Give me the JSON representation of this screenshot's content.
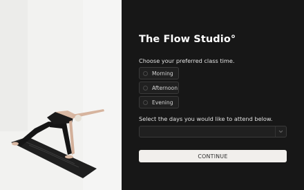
{
  "form": {
    "title": "The Flow Studio°",
    "class_time_label": "Choose your preferred class time.",
    "class_time_options": [
      "Morning",
      "Afternoon",
      "Evening"
    ],
    "days_label": "Select the days you would like to attend below.",
    "days_select_value": "",
    "continue_label": "CONTINUE"
  },
  "icons": {
    "select_chevron": "chevron-down-icon"
  },
  "colors": {
    "panel_background": "#171717",
    "button_background": "#f1efec"
  }
}
